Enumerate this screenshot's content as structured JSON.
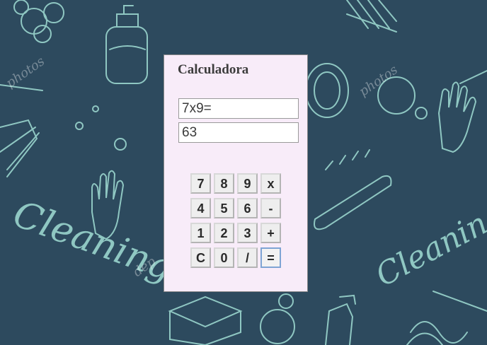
{
  "window": {
    "title": "Calculadora"
  },
  "calculator": {
    "expression": "7x9=",
    "result": "63",
    "keys": [
      "7",
      "8",
      "9",
      "x",
      "4",
      "5",
      "6",
      "-",
      "1",
      "2",
      "3",
      "+",
      "C",
      "0",
      "/",
      "="
    ]
  },
  "background": {
    "watermark_text": "Cleaning",
    "stock_text": "photos",
    "colors": {
      "background": "#2d4a5e",
      "doodle": "#8fc7c2",
      "panel": "#f8ecf9"
    }
  }
}
